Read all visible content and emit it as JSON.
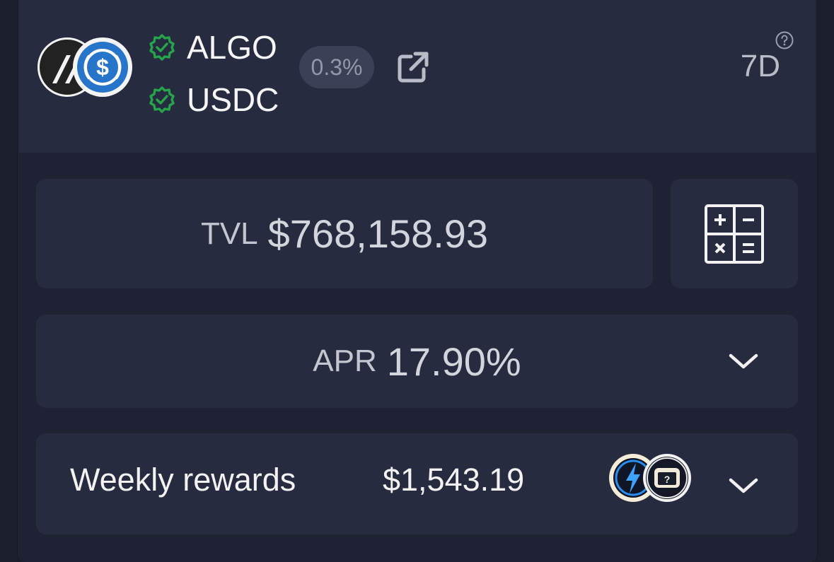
{
  "pool": {
    "tokens": [
      {
        "symbol": "ALGO",
        "verified": true,
        "icon": "algo-logo"
      },
      {
        "symbol": "USDC",
        "verified": true,
        "icon": "usdc-logo"
      }
    ],
    "fee": "0.3%",
    "period": "7D"
  },
  "tvl": {
    "label": "TVL",
    "value": "$768,158.93"
  },
  "apr": {
    "label": "APR",
    "value": "17.90%"
  },
  "rewards": {
    "label": "Weekly rewards",
    "value": "$1,543.19",
    "token_icons": [
      "bolt-token-icon",
      "unknown-token-icon"
    ]
  },
  "colors": {
    "background": "#1b1e2c",
    "header": "#262b40",
    "panel": "#262b3f",
    "verified": "#27a44a",
    "usdc": "#2775ca"
  }
}
